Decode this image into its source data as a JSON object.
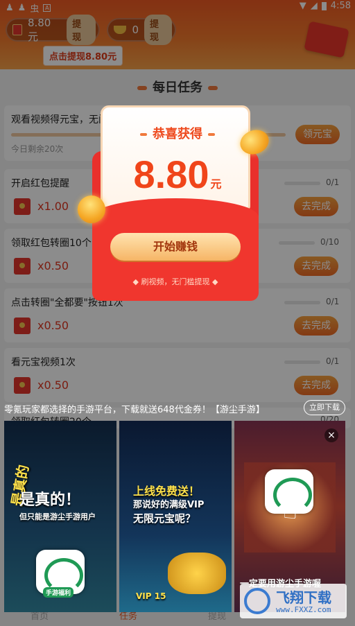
{
  "status_bar": {
    "time": "4:58",
    "left_icons": [
      "qq-icon",
      "qq-icon",
      "app-icon",
      "a-icon"
    ],
    "right_icons": [
      "wifi-icon",
      "signal-icon",
      "battery-icon"
    ]
  },
  "header": {
    "cash": {
      "amount": "8.80元",
      "button": "提现"
    },
    "gold": {
      "amount": "0",
      "button": "提现"
    },
    "tip": "点击提现8.80元"
  },
  "section_title": "每日任务",
  "tasks": [
    {
      "title": "观看视频得元宝，无门",
      "sub": "今日剩余20次",
      "button": "领元宝"
    },
    {
      "title": "开启红包提醒",
      "reward": "x1.00",
      "progress": "0/1",
      "progress_value": 0,
      "button": "去完成"
    },
    {
      "title": "领取红包转圈10个",
      "reward": "x0.50",
      "progress": "0/10",
      "progress_value": 0,
      "button": "去完成"
    },
    {
      "title": "点击转圈\"全都要\"按钮1次",
      "reward": "x0.50",
      "progress": "0/1",
      "progress_value": 0,
      "button": "去完成"
    },
    {
      "title": "看元宝视频1次",
      "reward": "x0.50",
      "progress": "0/1",
      "progress_value": 0,
      "button": "去完成"
    },
    {
      "title": "领取红包转圈20个",
      "progress": "0/20",
      "progress_value": 0
    }
  ],
  "popup": {
    "title": "恭喜获得",
    "amount": "8.80",
    "unit": "元",
    "button": "开始赚钱",
    "footer": "刷视频，无门槛提现"
  },
  "ad": {
    "text": "零氪玩家都选择的手游平台，下载就送648代金券！【游尘手游】",
    "download": "立即下载",
    "panel1": {
      "side": "是真的",
      "headline": "是真的！",
      "sub": "但只能是游尘手游用户",
      "badge": "手游福利"
    },
    "panel2": {
      "headline": "上线免费送！",
      "line2": "那说好的满级VIP",
      "line3": "无限元宝呢？",
      "vip": "VIP 15"
    },
    "panel3": {
      "caption": "一定要用游尘手游喔"
    },
    "close": "×"
  },
  "bottom_nav": [
    {
      "label": "首页"
    },
    {
      "label": "任务"
    },
    {
      "label": "提现"
    }
  ],
  "watermark": {
    "text": "飞翔下载",
    "url": "www.FXXZ.com"
  },
  "colors": {
    "accent": "#f05a23",
    "button": "#ee6a25",
    "popup_red": "#e9302c"
  }
}
